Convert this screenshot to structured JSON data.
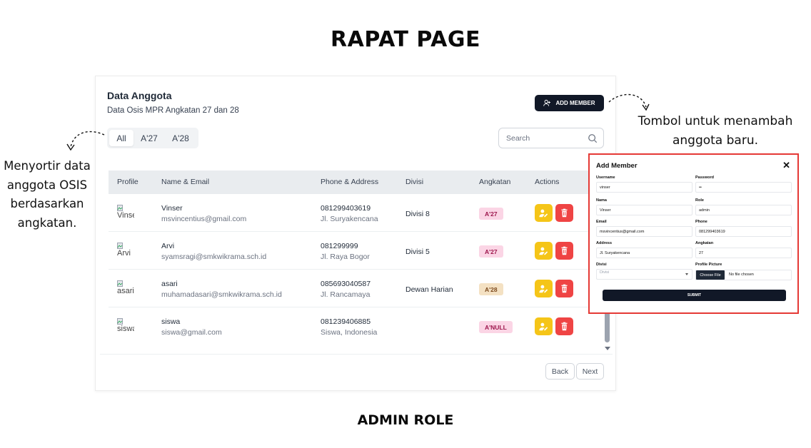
{
  "page_title": "RAPAT PAGE",
  "footer_title": "ADMIN ROLE",
  "card": {
    "title": "Data Anggota",
    "subtitle": "Data Osis MPR Angkatan 27 dan 28",
    "add_button": "ADD MEMBER",
    "filters": [
      "All",
      "A'27",
      "A'28"
    ],
    "active_filter": "All",
    "search_placeholder": "Search",
    "columns": [
      "Profile",
      "Name & Email",
      "Phone & Address",
      "Divisi",
      "Angkatan",
      "Actions"
    ],
    "rows": [
      {
        "profile_alt": "Vinser",
        "name": "Vinser",
        "email": "msvincentius@gmail.com",
        "phone": "081299403619",
        "address": "Jl. Suryakencana",
        "divisi": "Divisi 8",
        "angkatan": "A'27"
      },
      {
        "profile_alt": "Arvi",
        "name": "Arvi",
        "email": "syamsragi@smkwikrama.sch.id",
        "phone": "081299999",
        "address": "Jl. Raya Bogor",
        "divisi": "Divisi 5",
        "angkatan": "A'27"
      },
      {
        "profile_alt": "asari",
        "name": "asari",
        "email": "muhamadasari@smkwikrama.sch.id",
        "phone": "085693040587",
        "address": "Jl. Rancamaya",
        "divisi": "Dewan Harian",
        "angkatan": "A'28"
      },
      {
        "profile_alt": "siswa",
        "name": "siswa",
        "email": "siswa@gmail.com",
        "phone": "081239406885",
        "address": "Siswa, Indonesia",
        "divisi": "",
        "angkatan": "A'NULL"
      }
    ],
    "pagination": {
      "back": "Back",
      "next": "Next"
    }
  },
  "annotations": {
    "left": "Menyortir data anggota OSIS berdasarkan angkatan.",
    "right": "Tombol untuk menambah anggota baru."
  },
  "modal": {
    "title": "Add Member",
    "close": "✕",
    "fields": {
      "username": {
        "label": "Username",
        "value": "vinser"
      },
      "password": {
        "label": "Password",
        "value": "••"
      },
      "nama": {
        "label": "Nama",
        "value": "Vinser"
      },
      "role": {
        "label": "Role",
        "value": "admin"
      },
      "email": {
        "label": "Email",
        "value": "msvincentius@gmail.com"
      },
      "phone": {
        "label": "Phone",
        "value": "081299403619"
      },
      "address": {
        "label": "Address",
        "value": "Jl. Suryakencana"
      },
      "angkatan": {
        "label": "Angkatan",
        "value": "27"
      },
      "divisi": {
        "label": "Divisi",
        "value": "Divisi"
      },
      "profile_picture": {
        "label": "Profile Picture",
        "button": "Choose File",
        "status": "No file chosen"
      }
    },
    "submit": "SUBMIT"
  },
  "colors": {
    "accent_dark": "#111827",
    "edit_yellow": "#f5c518",
    "delete_red": "#ef4444",
    "highlight_border": "#e53935",
    "badge_pink": "#fbd5e5",
    "badge_tan": "#f4e1c3"
  },
  "icons": {
    "add_member": "user-plus-icon",
    "search": "search-icon",
    "edit": "edit-user-icon",
    "delete": "trash-icon",
    "profile": "broken-image-icon"
  }
}
